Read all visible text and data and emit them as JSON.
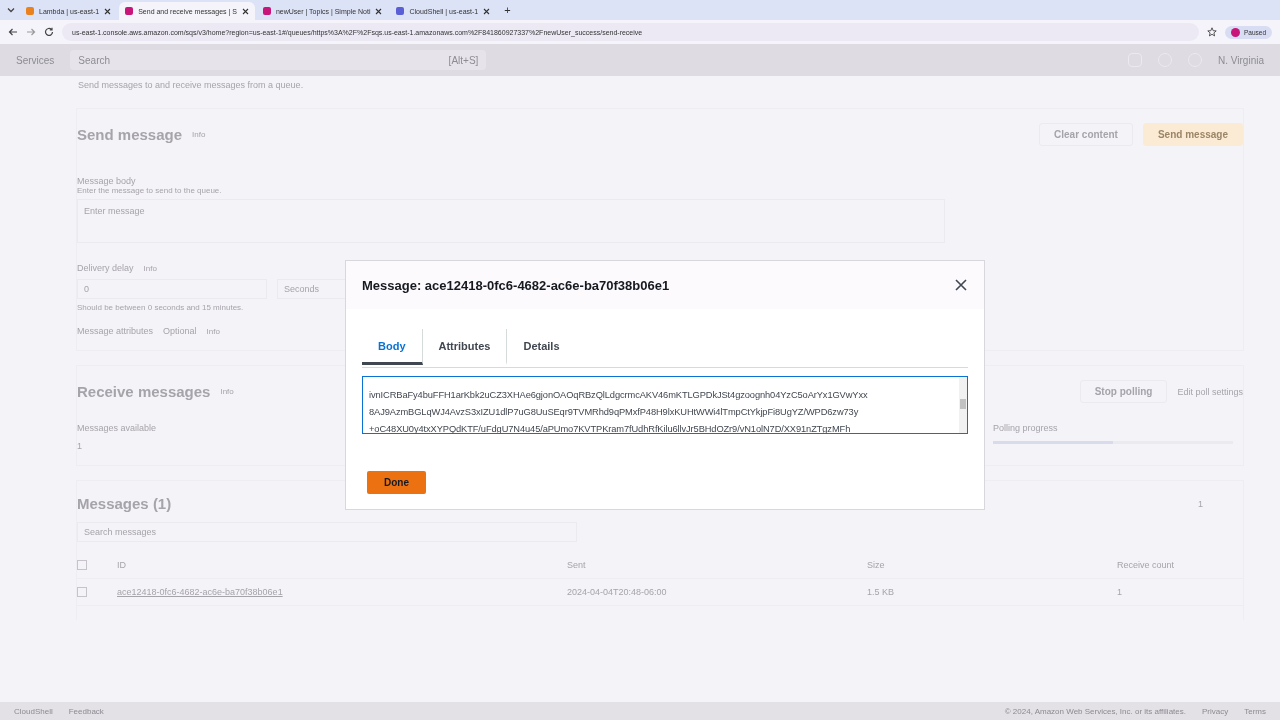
{
  "browser": {
    "tabs": [
      {
        "title": "Lambda | us-east-1",
        "selected": false
      },
      {
        "title": "Send and receive messages | S",
        "selected": true
      },
      {
        "title": "newUser | Topics | Simple Noti",
        "selected": false
      },
      {
        "title": "CloudShell | us-east-1",
        "selected": false
      }
    ],
    "new_tab": "+",
    "url": "us-east-1.console.aws.amazon.com/sqs/v3/home?region=us-east-1#/queues/https%3A%2F%2Fsqs.us-east-1.amazonaws.com%2F841860927337%2FnewUser_success/send-receive",
    "profile": "Paused"
  },
  "nav": {
    "services": "Services",
    "search_placeholder": "Search",
    "shortcut": "[Alt+S]",
    "region": "N. Virginia"
  },
  "page": {
    "intro": "Send messages to and receive messages from a queue.",
    "send": {
      "title": "Send message",
      "info": "Info",
      "clear": "Clear content",
      "send": "Send message",
      "body_label": "Message body",
      "body_hint": "Enter the message to send to the queue.",
      "body_placeholder": "Enter message",
      "delay_label": "Delivery delay",
      "delay_info": "Info",
      "delay_value": "0",
      "delay_unit": "Seconds",
      "delay_hint": "Should be between 0 seconds and 15 minutes.",
      "attributes": "Message attributes",
      "optional": "Optional",
      "attributes_info": "Info"
    },
    "receive": {
      "title": "Receive messages",
      "info": "Info",
      "stop": "Stop polling",
      "edit": "Edit poll settings",
      "available": "Messages available",
      "available_value": "1",
      "polling": "Polling progress",
      "level": 0.5
    },
    "messages": {
      "title": "Messages (1)",
      "search_placeholder": "Search messages",
      "page": "1",
      "columns": [
        "ID",
        "Sent",
        "Size",
        "Receive count"
      ],
      "select_all_checked": false,
      "rows": [
        {
          "checked": false,
          "id": "ace12418-0fc6-4682-ac6e-ba70f38b06e1",
          "sent": "2024-04-04T20:48-06:00",
          "size": "1.5 KB",
          "receive_count": "1"
        }
      ]
    }
  },
  "footer": {
    "links": [
      "CloudShell",
      "Feedback"
    ],
    "copyright": "© 2024, Amazon Web Services, Inc. or its affiliates.",
    "right_links": [
      "Privacy",
      "Terms"
    ]
  },
  "modal": {
    "title": "Message: ace12418-0fc6-4682-ac6e-ba70f38b06e1",
    "tabs": [
      {
        "label": "Body",
        "selected": true
      },
      {
        "label": "Attributes",
        "selected": false
      },
      {
        "label": "Details",
        "selected": false
      }
    ],
    "body_lines": [
      "ivnICRBaFy4buFFH1arKbk2uCZ3XHAe6gjonOAOqRBzQlLdgcrmcAKV46mKTLGPDkJSt4gzoognh04YzC5oArYx1GVwYxx",
      "8AJ9AzmBGLqWJ4AvzS3xIZU1dlP7uG8UuSEqr9TVMRhd9qPMxfP48H9lxKUHtWWi4lTmpCtYkjpFi8UgYZ/WPD6zw73y",
      "+oC48XU0y4txXYPQdKTF/uFdgU7N4u45/aPUmo7KVTPKram7fUdhRfKilu6llvJr5BHdOZr9/vN1olN7D/XX91nZTgzMFh"
    ],
    "done": "Done"
  }
}
